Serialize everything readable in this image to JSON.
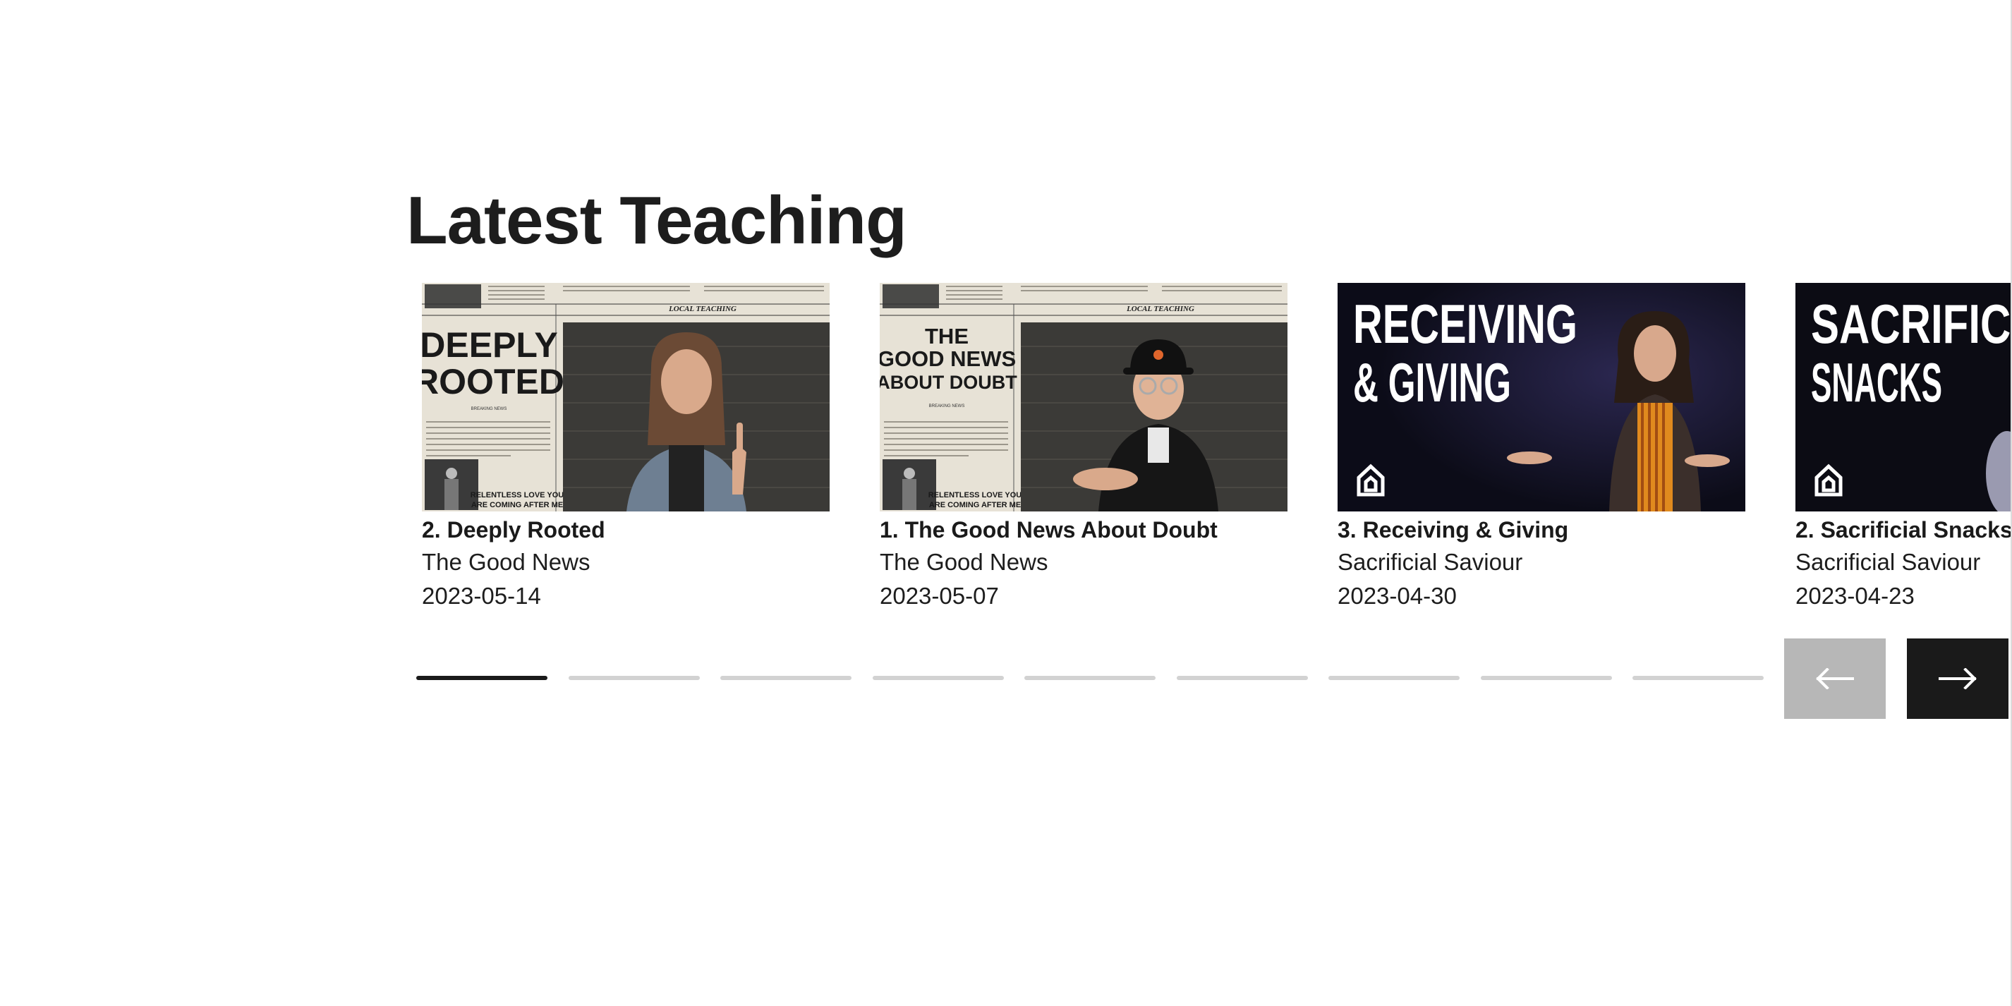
{
  "section": {
    "title": "Latest Teaching"
  },
  "cards": [
    {
      "title": "2. Deeply Rooted",
      "series": "The Good News",
      "date": "2023-05-14",
      "thumb": {
        "headline_lines": [
          "DEEPLY",
          "ROOTED"
        ],
        "tag": "LOCAL TEACHING",
        "byline": "BREAKING NEWS",
        "footer_lines": [
          "RELENTLESS LOVE YOU",
          "ARE COMING AFTER ME"
        ]
      }
    },
    {
      "title": "1. The Good News About Doubt",
      "series": "The Good News",
      "date": "2023-05-07",
      "thumb": {
        "headline_lines": [
          "THE",
          "GOOD NEWS",
          "ABOUT DOUBT"
        ],
        "tag": "LOCAL TEACHING",
        "byline": "BREAKING NEWS",
        "footer_lines": [
          "RELENTLESS LOVE YOU",
          "ARE COMING AFTER ME"
        ]
      }
    },
    {
      "title": "3. Receiving & Giving",
      "series": "Sacrificial Saviour",
      "date": "2023-04-30",
      "thumb": {
        "headline_lines": [
          "RECEIVING",
          "& GIVING"
        ]
      }
    },
    {
      "title": "2. Sacrificial Snacks",
      "series": "Sacrificial Saviour",
      "date": "2023-04-23",
      "thumb": {
        "headline_lines": [
          "SACRIFICIAL",
          "SNACKS"
        ]
      }
    }
  ],
  "carousel": {
    "total_pages": 9,
    "current_page": 1,
    "prev_label": "Previous",
    "next_label": "Next"
  },
  "colors": {
    "newsprint": "#e7e2d6",
    "dark_navy": "#14142a",
    "active_indicator": "#1a1a1a",
    "inactive_indicator": "#d2d2d2",
    "prev_button": "#b7b7b7",
    "next_button": "#1a1a1a"
  },
  "icons": {
    "prev": "arrow-left-icon",
    "next": "arrow-right-icon",
    "brand": "house-logo-icon"
  }
}
